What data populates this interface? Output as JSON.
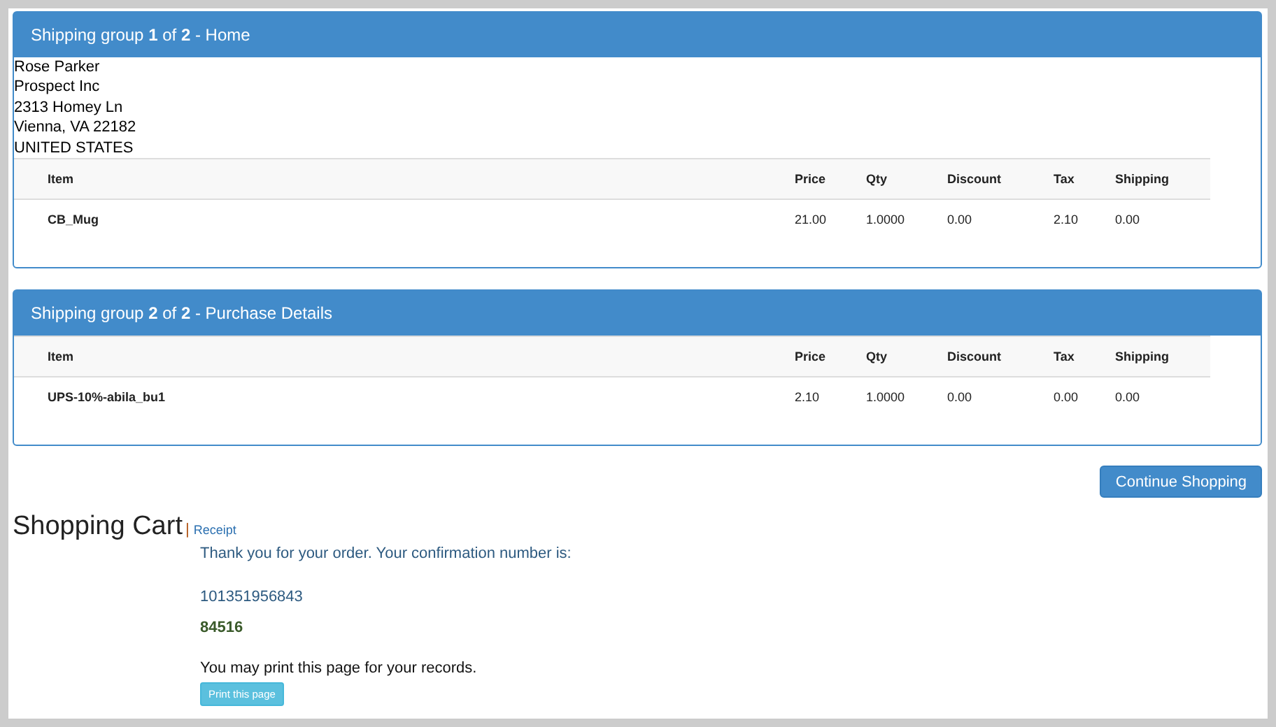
{
  "shipping_groups": [
    {
      "title": "Shipping group **1** of **2** - Home",
      "address": [
        "Rose Parker",
        "Prospect Inc",
        "2313 Homey Ln",
        "Vienna, VA 22182",
        "UNITED STATES"
      ],
      "columns": [
        "Item",
        "Price",
        "Qty",
        "Discount",
        "Tax",
        "Shipping"
      ],
      "rows": [
        [
          "CB_Mug",
          "21.00",
          "1.0000",
          "0.00",
          "2.10",
          "0.00"
        ]
      ]
    },
    {
      "title": "Shipping group **2** of **2** - Purchase Details",
      "columns": [
        "Item",
        "Price",
        "Qty",
        "Discount",
        "Tax",
        "Shipping"
      ],
      "rows": [
        [
          "UPS-10%-abila_bu1",
          "2.10",
          "1.0000",
          "0.00",
          "0.00",
          "0.00"
        ]
      ]
    }
  ],
  "continue_button": "Continue Shopping",
  "heading": "Shopping Cart",
  "separator": "|",
  "receipt_link": "Receipt",
  "thank_you": "Thank you for your order. Your confirmation number is:",
  "confirmation_number": "101351956843",
  "order_code": "84516",
  "print_note": "You may print this page for your records.",
  "print_button": "Print this page"
}
